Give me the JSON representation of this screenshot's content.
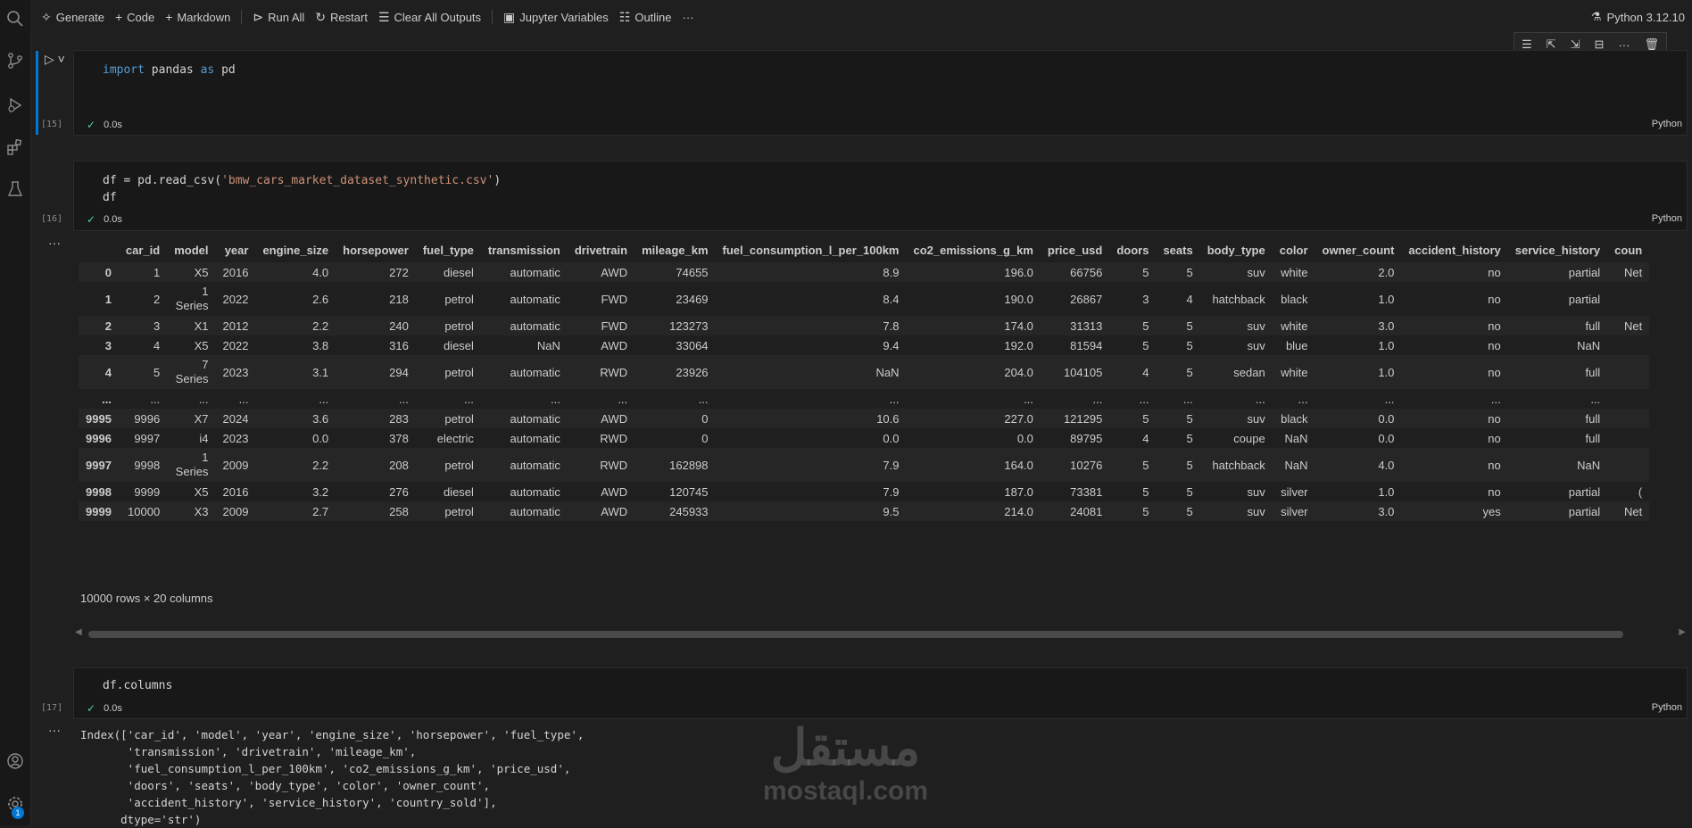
{
  "toolbar": {
    "generate": "Generate",
    "code": "Code",
    "markdown": "Markdown",
    "run_all": "Run All",
    "restart": "Restart",
    "clear_all_outputs": "Clear All Outputs",
    "jupyter_variables": "Jupyter Variables",
    "outline": "Outline",
    "more": "···",
    "kernel": "Python 3.12.10"
  },
  "cells": [
    {
      "exec_count": "[15]",
      "code_lines": [
        "import pandas as pd"
      ],
      "time": "0.0s",
      "language": "Python"
    },
    {
      "exec_count": "[16]",
      "code_lines": [
        "df = pd.read_csv('bmw_cars_market_dataset_synthetic.csv')",
        "df"
      ],
      "time": "0.0s",
      "language": "Python"
    },
    {
      "exec_count": "[17]",
      "code_lines": [
        "df.columns"
      ],
      "time": "0.0s",
      "language": "Python"
    }
  ],
  "dataframe": {
    "columns": [
      "",
      "car_id",
      "model",
      "year",
      "engine_size",
      "horsepower",
      "fuel_type",
      "transmission",
      "drivetrain",
      "mileage_km",
      "fuel_consumption_l_per_100km",
      "co2_emissions_g_km",
      "price_usd",
      "doors",
      "seats",
      "body_type",
      "color",
      "owner_count",
      "accident_history",
      "service_history",
      "coun"
    ],
    "rows": [
      [
        "0",
        "1",
        "X5",
        "2016",
        "4.0",
        "272",
        "diesel",
        "automatic",
        "AWD",
        "74655",
        "8.9",
        "196.0",
        "66756",
        "5",
        "5",
        "suv",
        "white",
        "2.0",
        "no",
        "partial",
        "Net"
      ],
      [
        "1",
        "2",
        "1\nSeries",
        "2022",
        "2.6",
        "218",
        "petrol",
        "automatic",
        "FWD",
        "23469",
        "8.4",
        "190.0",
        "26867",
        "3",
        "4",
        "hatchback",
        "black",
        "1.0",
        "no",
        "partial",
        ""
      ],
      [
        "2",
        "3",
        "X1",
        "2012",
        "2.2",
        "240",
        "petrol",
        "automatic",
        "FWD",
        "123273",
        "7.8",
        "174.0",
        "31313",
        "5",
        "5",
        "suv",
        "white",
        "3.0",
        "no",
        "full",
        "Net"
      ],
      [
        "3",
        "4",
        "X5",
        "2022",
        "3.8",
        "316",
        "diesel",
        "NaN",
        "AWD",
        "33064",
        "9.4",
        "192.0",
        "81594",
        "5",
        "5",
        "suv",
        "blue",
        "1.0",
        "no",
        "NaN",
        ""
      ],
      [
        "4",
        "5",
        "7\nSeries",
        "2023",
        "3.1",
        "294",
        "petrol",
        "automatic",
        "RWD",
        "23926",
        "NaN",
        "204.0",
        "104105",
        "4",
        "5",
        "sedan",
        "white",
        "1.0",
        "no",
        "full",
        ""
      ],
      [
        "...",
        "...",
        "...",
        "...",
        "...",
        "...",
        "...",
        "...",
        "...",
        "...",
        "...",
        "...",
        "...",
        "...",
        "...",
        "...",
        "...",
        "...",
        "...",
        "...",
        ""
      ],
      [
        "9995",
        "9996",
        "X7",
        "2024",
        "3.6",
        "283",
        "petrol",
        "automatic",
        "AWD",
        "0",
        "10.6",
        "227.0",
        "121295",
        "5",
        "5",
        "suv",
        "black",
        "0.0",
        "no",
        "full",
        ""
      ],
      [
        "9996",
        "9997",
        "i4",
        "2023",
        "0.0",
        "378",
        "electric",
        "automatic",
        "RWD",
        "0",
        "0.0",
        "0.0",
        "89795",
        "4",
        "5",
        "coupe",
        "NaN",
        "0.0",
        "no",
        "full",
        ""
      ],
      [
        "9997",
        "9998",
        "1\nSeries",
        "2009",
        "2.2",
        "208",
        "petrol",
        "automatic",
        "RWD",
        "162898",
        "7.9",
        "164.0",
        "10276",
        "5",
        "5",
        "hatchback",
        "NaN",
        "4.0",
        "no",
        "NaN",
        ""
      ],
      [
        "9998",
        "9999",
        "X5",
        "2016",
        "3.2",
        "276",
        "diesel",
        "automatic",
        "AWD",
        "120745",
        "7.9",
        "187.0",
        "73381",
        "5",
        "5",
        "suv",
        "silver",
        "1.0",
        "no",
        "partial",
        "("
      ],
      [
        "9999",
        "10000",
        "X3",
        "2009",
        "2.7",
        "258",
        "petrol",
        "automatic",
        "AWD",
        "245933",
        "9.5",
        "214.0",
        "24081",
        "5",
        "5",
        "suv",
        "silver",
        "3.0",
        "yes",
        "partial",
        "Net"
      ]
    ],
    "summary": "10000 rows × 20 columns"
  },
  "columns_output": "Index(['car_id', 'model', 'year', 'engine_size', 'horsepower', 'fuel_type',\n       'transmission', 'drivetrain', 'mileage_km',\n       'fuel_consumption_l_per_100km', 'co2_emissions_g_km', 'price_usd',\n       'doors', 'seats', 'body_type', 'color', 'owner_count',\n       'accident_history', 'service_history', 'country_sold'],\n      dtype='str')",
  "output_more": "···",
  "watermark": {
    "arabic": "مستقل",
    "latin": "mostaql.com"
  },
  "activity_badge": "1",
  "icons": [
    "search-icon",
    "source-control-icon",
    "run-debug-icon",
    "extensions-icon",
    "testing-icon",
    "account-icon",
    "settings-gear-icon"
  ]
}
